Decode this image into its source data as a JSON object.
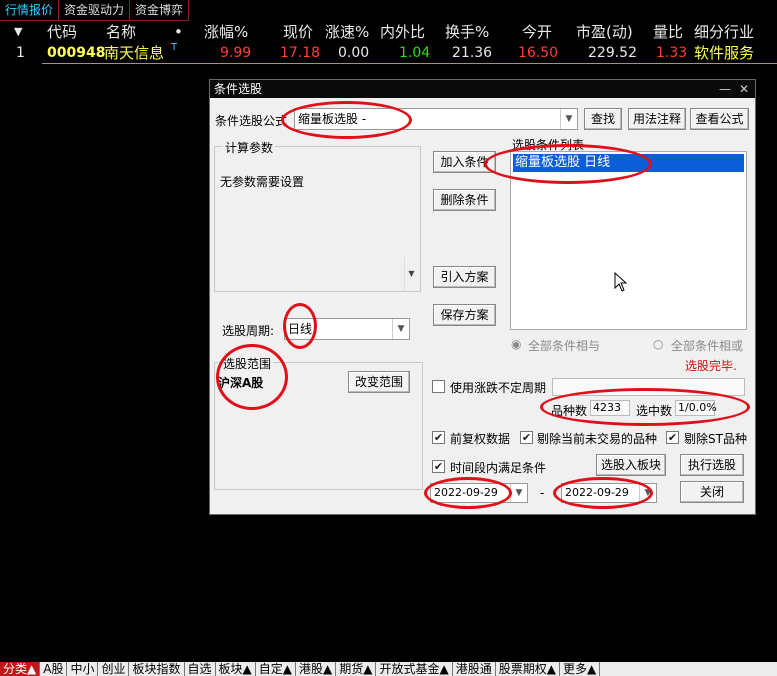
{
  "top_tabs": [
    "行情报价",
    "资金驱动力",
    "资金博弈"
  ],
  "quote_header": {
    "arrow": "▼",
    "code": "代码",
    "name": "名称",
    "dot": "•",
    "change_pct": "涨幅%",
    "price": "现价",
    "speed": "涨速%",
    "inout": "内外比",
    "turnover": "换手%",
    "open": "今开",
    "pe": "市盈(动)",
    "vol_ratio": "量比",
    "industry": "细分行业"
  },
  "quote_row": {
    "index": "1",
    "code": "000948",
    "name": "南天信息",
    "mark": "T",
    "change_pct": "9.99",
    "price": "17.18",
    "speed": "0.00",
    "inout": "1.04",
    "turnover": "21.36",
    "open": "16.50",
    "pe": "229.52",
    "vol_ratio": "1.33",
    "industry": "软件服务"
  },
  "dialog": {
    "title": "条件选股",
    "minimize": "—",
    "close": "✕",
    "formula_label": "条件选股公式",
    "formula_value": "缩量板选股   -",
    "find_btn": "查找",
    "usage_btn": "用法注释",
    "view_formula_btn": "查看公式",
    "params_title": "计算参数",
    "params_text": "无参数需要设置",
    "add_btn": "加入条件",
    "delete_btn": "删除条件",
    "import_btn": "引入方案",
    "save_btn": "保存方案",
    "cond_list_title": "选股条件列表",
    "cond_items": [
      "缩量板选股  日线"
    ],
    "period_label": "选股周期:",
    "period_value": "日线",
    "and_label": "全部条件相与",
    "or_label": "全部条件相或",
    "status": "选股完毕.",
    "scope_title": "选股范围",
    "scope_value": "沪深A股",
    "change_scope_btn": "改变范围",
    "use_period_label": "使用涨跌不定周期",
    "count_label": "品种数",
    "count_value": "4233",
    "selected_label": "选中数",
    "selected_value": "1/0.0%",
    "fq_label": "前复权数据",
    "exclude_untraded_label": "剔除当前未交易的品种",
    "exclude_st_label": "剔除ST品种",
    "time_range_label": "时间段内满足条件",
    "to_board_btn": "选股入板块",
    "run_btn": "执行选股",
    "start_date": "2022-09-29",
    "dash": "-",
    "end_date": "2022-09-29",
    "close_btn": "关闭"
  },
  "bottom_tabs": [
    "分类▲",
    "A股",
    "中小",
    "创业",
    "板块指数",
    "自选",
    "板块▲",
    "自定▲",
    "港股▲",
    "期货▲",
    "开放式基金▲",
    "港股通",
    "股票期权▲",
    "更多▲"
  ],
  "colors": {
    "yellow": "#ffff55",
    "red": "#ff3c3c",
    "green": "#20e020",
    "white": "#e8e8e8",
    "accent": "#2ad4ff",
    "annotation": "#e0101a",
    "selection": "#0a5fd8"
  }
}
